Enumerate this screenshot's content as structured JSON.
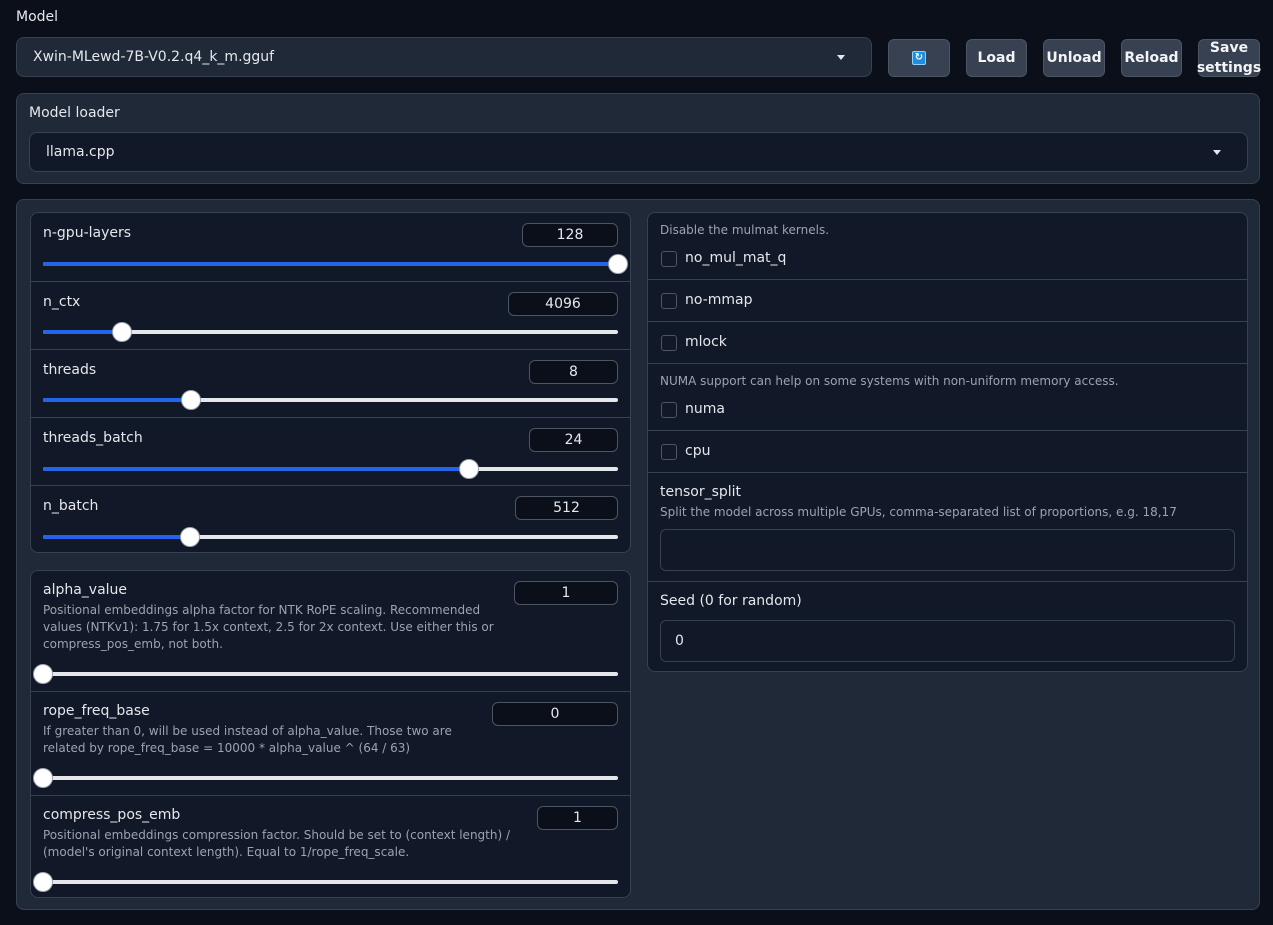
{
  "model": {
    "label": "Model",
    "selected": "Xwin-MLewd-7B-V0.2.q4_k_m.gguf"
  },
  "buttons": {
    "refresh_icon": "refresh-icon",
    "load": "Load",
    "unload": "Unload",
    "reload": "Reload",
    "save_line1": "Save",
    "save_line2": "settings"
  },
  "loader": {
    "label": "Model loader",
    "selected": "llama.cpp"
  },
  "sliders_a": [
    {
      "name": "n-gpu-layers",
      "value": "128",
      "fraction": 1.0
    },
    {
      "name": "n_ctx",
      "value": "4096",
      "fraction": 0.137
    },
    {
      "name": "threads",
      "value": "8",
      "fraction": 0.258
    },
    {
      "name": "threads_batch",
      "value": "24",
      "fraction": 0.74
    },
    {
      "name": "n_batch",
      "value": "512",
      "fraction": 0.256
    }
  ],
  "sliders_b": [
    {
      "name": "alpha_value",
      "value": "1",
      "fraction": 0.0,
      "desc": "Positional embeddings alpha factor for NTK RoPE scaling. Recommended values (NTKv1): 1.75 for 1.5x context, 2.5 for 2x context. Use either this or compress_pos_emb, not both."
    },
    {
      "name": "rope_freq_base",
      "value": "0",
      "fraction": 0.0,
      "desc": "If greater than 0, will be used instead of alpha_value. Those two are related by rope_freq_base = 10000 * alpha_value ^ (64 / 63)"
    },
    {
      "name": "compress_pos_emb",
      "value": "1",
      "fraction": 0.0,
      "desc": "Positional embeddings compression factor. Should be set to (context length) / (model's original context length). Equal to 1/rope_freq_scale."
    }
  ],
  "options": {
    "mulmat_info": "Disable the mulmat kernels.",
    "no_mul_mat_q": "no_mul_mat_q",
    "no_mmap": "no-mmap",
    "mlock": "mlock",
    "numa_info": "NUMA support can help on some systems with non-uniform memory access.",
    "numa": "numa",
    "cpu": "cpu",
    "tensor_split_label": "tensor_split",
    "tensor_split_info": "Split the model across multiple GPUs, comma-separated list of proportions, e.g. 18,17",
    "tensor_split_value": "",
    "seed_label": "Seed (0 for random)",
    "seed_value": "0"
  },
  "colors": {
    "background": "#0b0f19",
    "panel": "#1f2937",
    "accent": "#2563eb"
  }
}
